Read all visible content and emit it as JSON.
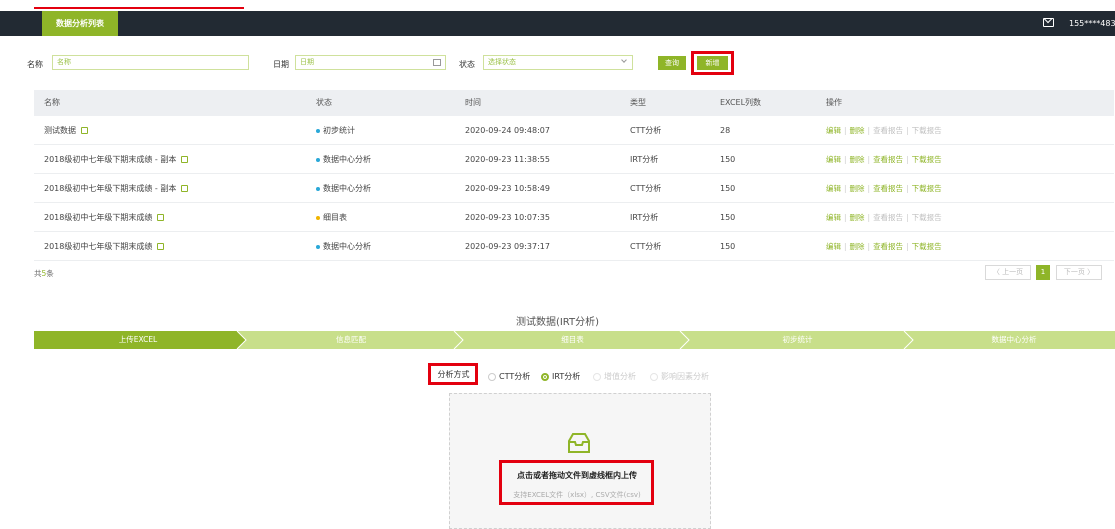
{
  "header": {
    "tab_label": "数据分析列表",
    "user_phone": "155****4837"
  },
  "filters": {
    "name_label": "名称",
    "name_placeholder": "名称",
    "date_label": "日期",
    "date_placeholder": "日期",
    "status_label": "状态",
    "status_placeholder": "选择状态",
    "query_button": "查询",
    "add_button": "新增"
  },
  "table": {
    "columns": [
      "名称",
      "状态",
      "时间",
      "类型",
      "EXCEL列数",
      "操作"
    ],
    "rows": [
      {
        "name": "测试数据",
        "status": "初步统计",
        "status_color": "#2aa8d8",
        "time": "2020-09-24 09:48:07",
        "type": "CTT分析",
        "cols": "28",
        "ops_active": [
          "编辑",
          "删除"
        ],
        "ops_inactive": [
          "查看报告",
          "下载报告"
        ]
      },
      {
        "name": "2018级初中七年级下期末成绩 - 副本",
        "status": "数据中心分析",
        "status_color": "#2aa8d8",
        "time": "2020-09-23 11:38:55",
        "type": "IRT分析",
        "cols": "150",
        "ops_active": [
          "编辑",
          "删除",
          "查看报告",
          "下载报告"
        ],
        "ops_inactive": []
      },
      {
        "name": "2018级初中七年级下期末成绩 - 副本",
        "status": "数据中心分析",
        "status_color": "#2aa8d8",
        "time": "2020-09-23 10:58:49",
        "type": "CTT分析",
        "cols": "150",
        "ops_active": [
          "编辑",
          "删除",
          "查看报告",
          "下载报告"
        ],
        "ops_inactive": []
      },
      {
        "name": "2018级初中七年级下期末成绩",
        "status": "细目表",
        "status_color": "#f0b400",
        "time": "2020-09-23 10:07:35",
        "type": "IRT分析",
        "cols": "150",
        "ops_active": [
          "编辑",
          "删除"
        ],
        "ops_inactive": [
          "查看报告",
          "下载报告"
        ]
      },
      {
        "name": "2018级初中七年级下期末成绩",
        "status": "数据中心分析",
        "status_color": "#2aa8d8",
        "time": "2020-09-23 09:37:17",
        "type": "CTT分析",
        "cols": "150",
        "ops_active": [
          "编辑",
          "删除",
          "查看报告",
          "下载报告"
        ],
        "ops_inactive": []
      }
    ]
  },
  "pagination": {
    "total_prefix": "共",
    "total_count": "5",
    "total_suffix": "条",
    "prev": "〈 上一页",
    "current": "1",
    "next": "下一页 〉"
  },
  "analysis": {
    "title": "测试数据(IRT分析)",
    "steps": [
      "上传EXCEL",
      "信息匹配",
      "细目表",
      "初步统计",
      "数据中心分析"
    ],
    "method_label": "分析方式",
    "options": [
      {
        "label": "CTT分析",
        "checked": false,
        "enabled": true
      },
      {
        "label": "IRT分析",
        "checked": true,
        "enabled": true
      },
      {
        "label": "增值分析",
        "checked": false,
        "enabled": false
      },
      {
        "label": "影响因素分析",
        "checked": false,
        "enabled": false
      }
    ],
    "drop_title": "点击或者拖动文件到虚线框内上传",
    "drop_subtitle": "支持EXCEL文件（xlsx）, CSV文件(csv)"
  },
  "colors": {
    "accent": "#8fb528",
    "accent_light": "#c8df8a",
    "topbar": "#222a33",
    "highlight": "#e3000f"
  }
}
